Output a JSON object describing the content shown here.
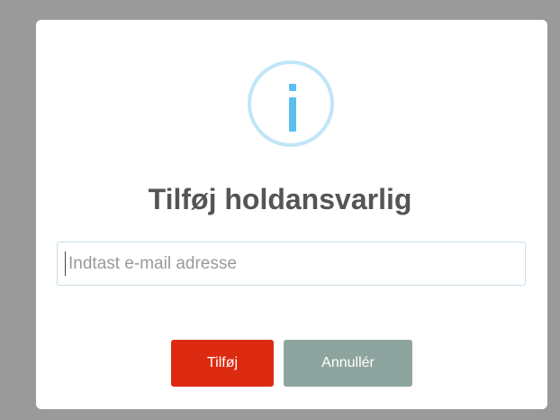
{
  "dialog": {
    "icon": "info-icon",
    "title": "Tilføj holdansvarlig",
    "email_input": {
      "value": "",
      "placeholder": "Indtast e-mail adresse"
    },
    "buttons": {
      "add_label": "Tilføj",
      "cancel_label": "Annullér"
    }
  },
  "colors": {
    "overlay": "#9a9a9a",
    "icon_ring": "#bfe6f6",
    "icon_glyph": "#5bc0ef",
    "add_button": "#dd2b12",
    "cancel_button": "#8ea59f",
    "title_text": "#555555"
  }
}
